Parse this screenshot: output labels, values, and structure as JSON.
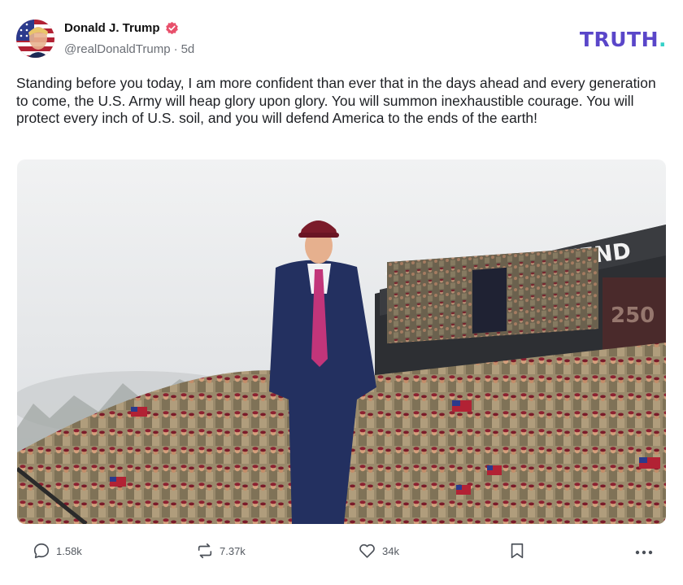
{
  "post": {
    "author": {
      "display_name": "Donald J. Trump",
      "handle": "@realDonaldTrump",
      "separator": "·",
      "time": "5d",
      "verified_color": "#e8506b"
    },
    "platform_logo": {
      "text": "TRUTH",
      "dot": ".",
      "color": "#5a46c9",
      "dot_color": "#35d1c8"
    },
    "text": "Standing before you today, I am more confident than ever that in the days ahead and every generation to come, the U.S. Army will heap glory upon glory. You will summon inexhaustible courage. You will protect every inch of U.S. soil, and you will defend America to the ends of the earth!",
    "image": {
      "billboard_text": "THIS WE'LL DEFEND",
      "billboard_number": "250"
    }
  },
  "actions": {
    "reply": {
      "icon": "reply-icon",
      "count": "1.58k"
    },
    "retruth": {
      "icon": "retruth-icon",
      "count": "7.37k"
    },
    "like": {
      "icon": "heart-icon",
      "count": "34k"
    },
    "bookmark": {
      "icon": "bookmark-icon"
    },
    "more": {
      "icon": "more-icon"
    }
  }
}
